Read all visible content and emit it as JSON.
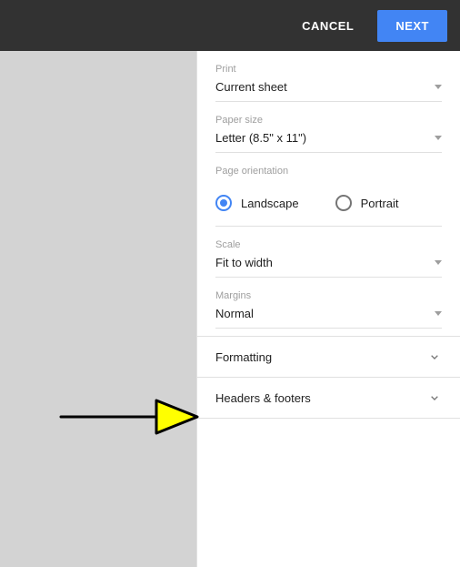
{
  "header": {
    "cancel": "CANCEL",
    "next": "NEXT"
  },
  "panel": {
    "print_label": "Print",
    "print_value": "Current sheet",
    "paper_label": "Paper size",
    "paper_value": "Letter (8.5\" x 11\")",
    "orientation_label": "Page orientation",
    "orientation_landscape": "Landscape",
    "orientation_portrait": "Portrait",
    "scale_label": "Scale",
    "scale_value": "Fit to width",
    "margins_label": "Margins",
    "margins_value": "Normal",
    "formatting": "Formatting",
    "headers_footers": "Headers & footers"
  }
}
